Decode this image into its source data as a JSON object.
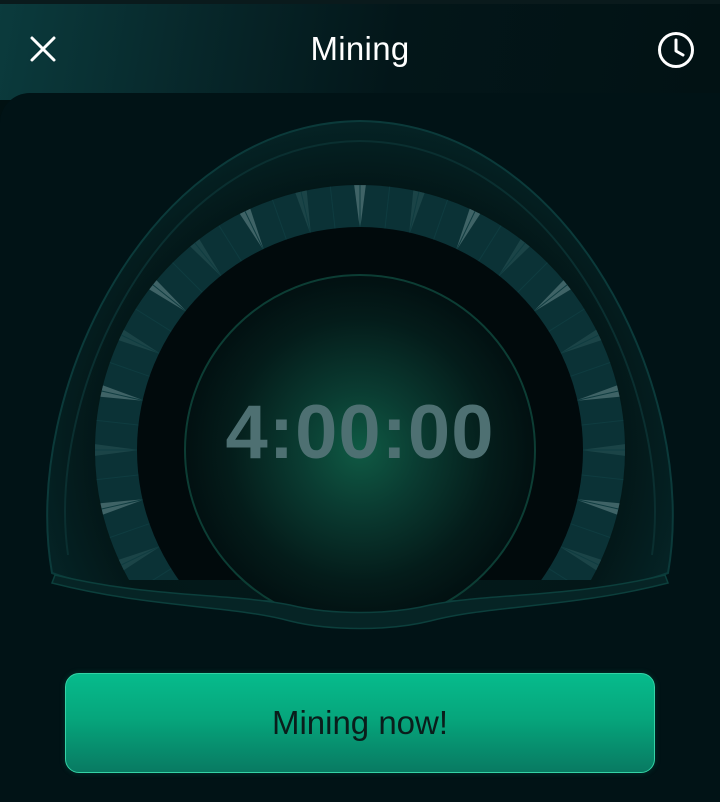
{
  "header": {
    "title": "Mining",
    "close_icon": "close-icon",
    "history_icon": "clock-icon"
  },
  "timer": {
    "value": "4:00:00"
  },
  "gauge": {
    "ticks": 28,
    "highlighted_ticks": 10
  },
  "action": {
    "label": "Mining now!"
  },
  "colors": {
    "background": "#011316",
    "accent": "#06bb8c",
    "timer_text": "#4e7072",
    "gauge_ring": "#0b3236"
  }
}
